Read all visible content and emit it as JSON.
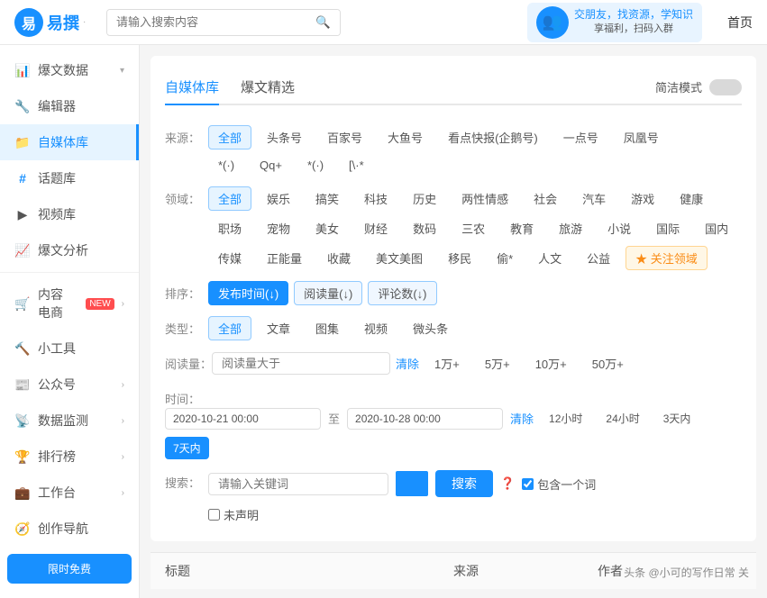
{
  "topNav": {
    "logoText": "易撰",
    "searchPlaceholder": "请输入搜索内容",
    "bannerLine1": "交朋友，找资源，学知识",
    "bannerLine2": "享福利，扫码入群",
    "homeLabel": "首页"
  },
  "sidebar": {
    "items": [
      {
        "id": "baowendata",
        "icon": "📊",
        "label": "爆文数据",
        "hasArrow": true,
        "active": false
      },
      {
        "id": "pinxiaoqi",
        "icon": "🔧",
        "label": "编辑器",
        "hasArrow": false,
        "active": false
      },
      {
        "id": "zimeiti",
        "icon": "📁",
        "label": "自媒体库",
        "hasArrow": false,
        "active": true
      },
      {
        "id": "huatiku",
        "icon": "#",
        "label": "话题库",
        "hasArrow": false,
        "active": false
      },
      {
        "id": "shipinku",
        "icon": "▶",
        "label": "视频库",
        "hasArrow": false,
        "active": false
      },
      {
        "id": "baowenfenxi",
        "icon": "📈",
        "label": "爆文分析",
        "hasArrow": false,
        "active": false
      },
      {
        "id": "neirongdianshang",
        "icon": "🛒",
        "label": "内容电商",
        "hasArrow": true,
        "active": false,
        "badge": "NEW"
      },
      {
        "id": "xiaogongju",
        "icon": "",
        "label": "小工具",
        "hasArrow": false,
        "active": false
      },
      {
        "id": "gongzonghao",
        "icon": "",
        "label": "公众号",
        "hasArrow": true,
        "active": false
      },
      {
        "id": "shujujiankong",
        "icon": "",
        "label": "数据监测",
        "hasArrow": true,
        "active": false
      },
      {
        "id": "paihangbang",
        "icon": "",
        "label": "排行榜",
        "hasArrow": true,
        "active": false
      },
      {
        "id": "gongtai",
        "icon": "",
        "label": "工作台",
        "hasArrow": true,
        "active": false
      },
      {
        "id": "chuangzuodaohang",
        "icon": "",
        "label": "创作导航",
        "hasArrow": false,
        "active": false
      }
    ]
  },
  "main": {
    "tabs": [
      {
        "id": "zimeiti",
        "label": "自媒体库",
        "active": true
      },
      {
        "id": "baowenjingxuan",
        "label": "爆文精选",
        "active": false
      },
      {
        "id": "jianjianmoshi",
        "label": "简洁模式",
        "active": false
      }
    ],
    "filters": {
      "sourceLabel": "来源：",
      "sourceTags": [
        {
          "label": "全部",
          "active": true
        },
        {
          "label": "头条号",
          "active": false
        },
        {
          "label": "百家号",
          "active": false
        },
        {
          "label": "大鱼号",
          "active": false
        },
        {
          "label": "看点快报(企鹅号)",
          "active": false
        },
        {
          "label": "一点号",
          "active": false
        },
        {
          "label": "凤凰号",
          "active": false
        }
      ],
      "sourceRow2": [
        "*(·)",
        "Qq+",
        "*(·)",
        "[\\·*"
      ],
      "domainLabel": "领域：",
      "domainTags": [
        {
          "label": "全部",
          "active": true
        },
        {
          "label": "娱乐",
          "active": false
        },
        {
          "label": "搞笑",
          "active": false
        },
        {
          "label": "科技",
          "active": false
        },
        {
          "label": "历史",
          "active": false
        },
        {
          "label": "两性情感",
          "active": false
        },
        {
          "label": "社会",
          "active": false
        },
        {
          "label": "汽车",
          "active": false
        },
        {
          "label": "游戏",
          "active": false
        },
        {
          "label": "健康",
          "active": false
        },
        {
          "label": "职场",
          "active": false
        },
        {
          "label": "宠物",
          "active": false
        },
        {
          "label": "美女",
          "active": false
        },
        {
          "label": "财经",
          "active": false
        },
        {
          "label": "数码",
          "active": false
        },
        {
          "label": "三农",
          "active": false
        },
        {
          "label": "教育",
          "active": false
        },
        {
          "label": "旅游",
          "active": false
        },
        {
          "label": "小说",
          "active": false
        },
        {
          "label": "国际",
          "active": false
        },
        {
          "label": "国内",
          "active": false
        },
        {
          "label": "传媒",
          "active": false
        },
        {
          "label": "正能量",
          "active": false
        },
        {
          "label": "收藏",
          "active": false
        },
        {
          "label": "美文美图",
          "active": false
        },
        {
          "label": "移民",
          "active": false
        },
        {
          "label": "偷*",
          "active": false
        },
        {
          "label": "人文",
          "active": false
        },
        {
          "label": "公益",
          "active": false
        }
      ],
      "domainLinkLabel": "★ 关注领域",
      "sortLabel": "排序：",
      "sortTags": [
        {
          "label": "发布时间(↓)",
          "active": true
        },
        {
          "label": "阅读量(↓)",
          "active": false
        },
        {
          "label": "评论数(↓)",
          "active": false
        }
      ],
      "typeLabel": "类型：",
      "typeTags": [
        {
          "label": "全部",
          "active": true
        },
        {
          "label": "文章",
          "active": false
        },
        {
          "label": "图集",
          "active": false
        },
        {
          "label": "视频",
          "active": false
        },
        {
          "label": "微头条",
          "active": false
        }
      ],
      "readLabel": "阅读量：",
      "readPlaceholder": "阅读量大于",
      "readClearLabel": "清除",
      "readQuick": [
        "1万+",
        "5万+",
        "10万+",
        "50万+"
      ],
      "timeLabel": "时间：",
      "timeStart": "2020-10-21 00:00",
      "timeSep": "至",
      "timeEnd": "2020-10-28 00:00",
      "timeClearLabel": "清除",
      "timeQuick": [
        "12小时",
        "24小时",
        "3天内",
        "7天内"
      ],
      "timeActiveIndex": 3,
      "searchLabel": "搜索：",
      "searchPlaceholder": "请输入关键词",
      "searchBtnLabel": "搜索",
      "searchHelpLabel": "?",
      "searchCheckboxLabel": "包含一个词",
      "undeclaredLabel": "未声明"
    },
    "table": {
      "headers": [
        "标题",
        "来源",
        "作者"
      ]
    }
  },
  "watermark": "头条 @小可的写作日常 关"
}
